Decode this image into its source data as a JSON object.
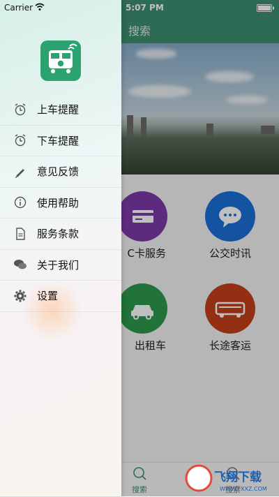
{
  "status_left": {
    "carrier": "Carrier"
  },
  "status_right": {
    "time": "5:07 PM"
  },
  "header": {
    "title": "搜索"
  },
  "services": [
    {
      "label": "C卡服务",
      "color": "#7d3aa8",
      "icon": "card-icon"
    },
    {
      "label": "公交时讯",
      "color": "#1a6fd8",
      "icon": "chat-bubble-icon"
    },
    {
      "label": "出租车",
      "color": "#2c9a4d",
      "icon": "taxi-icon"
    },
    {
      "label": "长途客运",
      "color": "#c4401a",
      "icon": "coach-bus-icon"
    }
  ],
  "tabbar": {
    "tabs": [
      {
        "label": "搜索",
        "icon": "search-icon"
      },
      {
        "label": "搜索",
        "icon": "search-icon"
      }
    ]
  },
  "watermark": {
    "text": "飞翔下载",
    "url": "WWW.FXXZ.COM"
  },
  "drawer": {
    "logo_icon": "bus-alarm-icon",
    "items": [
      {
        "label": "上车提醒",
        "icon": "alarm-clock-icon"
      },
      {
        "label": "下车提醒",
        "icon": "alarm-clock-icon"
      },
      {
        "label": "意见反馈",
        "icon": "pencil-icon"
      },
      {
        "label": "使用帮助",
        "icon": "info-icon"
      },
      {
        "label": "服务条款",
        "icon": "document-icon"
      },
      {
        "label": "关于我们",
        "icon": "chat-icon"
      },
      {
        "label": "设置",
        "icon": "gear-icon"
      }
    ]
  },
  "colors": {
    "accent": "#3e8f70",
    "logo": "#2ca271"
  }
}
